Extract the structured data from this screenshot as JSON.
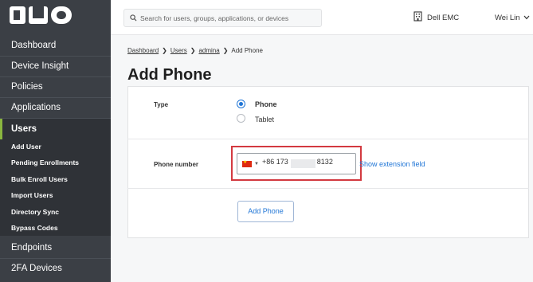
{
  "app": {
    "logo_text": "DUO"
  },
  "sidebar": {
    "items": [
      {
        "label": "Dashboard"
      },
      {
        "label": "Device Insight"
      },
      {
        "label": "Policies"
      },
      {
        "label": "Applications"
      },
      {
        "label": "Users"
      },
      {
        "label": "Endpoints"
      },
      {
        "label": "2FA Devices"
      }
    ],
    "sub_items": [
      {
        "label": "Add User"
      },
      {
        "label": "Pending Enrollments"
      },
      {
        "label": "Bulk Enroll Users"
      },
      {
        "label": "Import Users"
      },
      {
        "label": "Directory Sync"
      },
      {
        "label": "Bypass Codes"
      }
    ],
    "active": "Users"
  },
  "header": {
    "search_placeholder": "Search for users, groups, applications, or devices",
    "organization": "Dell EMC",
    "user_name": "Wei Lin"
  },
  "breadcrumb": [
    "Dashboard",
    "Users",
    "admina",
    "Add Phone"
  ],
  "page": {
    "title": "Add Phone",
    "type_label": "Type",
    "type_options": [
      {
        "label": "Phone",
        "selected": true
      },
      {
        "label": "Tablet",
        "selected": false
      }
    ],
    "phone_label": "Phone number",
    "phone_prefix": "+86 173",
    "phone_suffix": "8132",
    "country": "CN",
    "extension_link": "Show extension field",
    "submit_label": "Add Phone"
  },
  "colors": {
    "sidebar_bg": "#3b3f45",
    "accent_blue": "#1f75d6",
    "highlight_red": "#d33a40",
    "active_marker": "#8ab63f"
  }
}
